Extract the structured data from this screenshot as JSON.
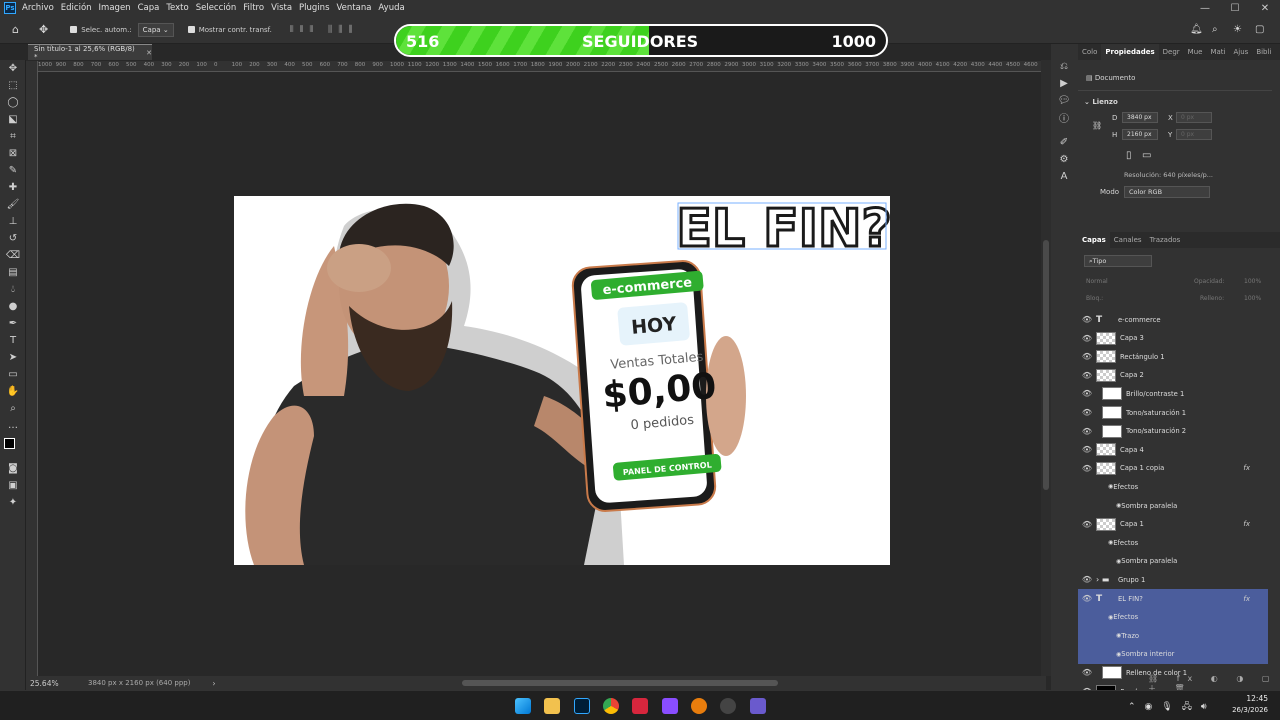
{
  "menubar": {
    "app_icon": "Ps",
    "items": [
      "Archivo",
      "Edición",
      "Imagen",
      "Capa",
      "Texto",
      "Selección",
      "Filtro",
      "Vista",
      "Plugins",
      "Ventana",
      "Ayuda"
    ]
  },
  "options_bar": {
    "auto_select_label": "Selec. autom.:",
    "auto_select_target": "Capa",
    "show_transform_label": "Mostrar contr. transf."
  },
  "overlay_bar": {
    "current": "516",
    "label": "SEGUIDORES",
    "goal": "1000",
    "progress_fraction": 0.516,
    "fill_color": "#3ed11e"
  },
  "document": {
    "tab_title": "Sin título-1 al 25,6% (RGB/8) *",
    "zoom": "25.64%",
    "size_info": "3840 px x 2160 px (640 ppp)"
  },
  "ruler_marks": [
    "1000",
    "900",
    "800",
    "700",
    "600",
    "500",
    "400",
    "300",
    "200",
    "100",
    "0",
    "100",
    "200",
    "300",
    "400",
    "500",
    "600",
    "700",
    "800",
    "900",
    "1000",
    "1100",
    "1200",
    "1300",
    "1400",
    "1500",
    "1600",
    "1700",
    "1800",
    "1900",
    "2000",
    "2100",
    "2200",
    "2300",
    "2400",
    "2500",
    "2600",
    "2700",
    "2800",
    "2900",
    "3000",
    "3100",
    "3200",
    "3300",
    "3400",
    "3500",
    "3600",
    "3700",
    "3800",
    "3900",
    "4000",
    "4100",
    "4200",
    "4300",
    "4400",
    "4500",
    "4600"
  ],
  "canvas": {
    "headline": "EL FIN?",
    "phone": {
      "banner": "e-commerce",
      "today": "HOY",
      "sales_label": "Ventas Totales",
      "amount": "$0,00",
      "orders": "0 pedidos",
      "button": "PANEL DE CONTROL"
    }
  },
  "properties_panel": {
    "tabs": [
      "Colo",
      "Propiedades",
      "Degr",
      "Mue",
      "Mati",
      "Ajus",
      "Bibli"
    ],
    "active_tab": "Propiedades",
    "doc_label": "Documento",
    "section": "Lienzo",
    "width_label": "D",
    "width_value": "3840 px",
    "height_label": "H",
    "height_value": "2160 px",
    "x_label": "X",
    "x_placeholder": "0 px",
    "y_label": "Y",
    "y_placeholder": "0 px",
    "resolution": "Resolución: 640 píxeles/p...",
    "mode_label": "Modo",
    "mode_value": "Color RGB"
  },
  "layers_panel": {
    "tabs": [
      "Capas",
      "Canales",
      "Trazados"
    ],
    "active_tab": "Capas",
    "filter": "Tipo",
    "blend_mode": "Normal",
    "opacity_label": "Opacidad:",
    "opacity_value": "100%",
    "lock_label": "Bloq.:",
    "fill_label": "Relleno:",
    "fill_value": "100%",
    "layers": [
      {
        "name": "e-commerce",
        "kind": "text"
      },
      {
        "name": "Capa 3",
        "kind": "layer"
      },
      {
        "name": "Rectángulo 1",
        "kind": "layer"
      },
      {
        "name": "Capa 2",
        "kind": "layer"
      },
      {
        "name": "Brillo/contraste 1",
        "kind": "adjust"
      },
      {
        "name": "Tono/saturación 1",
        "kind": "adjust"
      },
      {
        "name": "Tono/saturación 2",
        "kind": "adjust"
      },
      {
        "name": "Capa 4",
        "kind": "layer"
      },
      {
        "name": "Capa 1 copia",
        "kind": "layer",
        "fx": "fx"
      },
      {
        "name": "Efectos",
        "kind": "sub"
      },
      {
        "name": "Sombra paralela",
        "kind": "sub2"
      },
      {
        "name": "Capa 1",
        "kind": "layer",
        "fx": "fx"
      },
      {
        "name": "Efectos",
        "kind": "sub"
      },
      {
        "name": "Sombra paralela",
        "kind": "sub2"
      },
      {
        "name": "Grupo 1",
        "kind": "group"
      },
      {
        "name": "EL FIN?",
        "kind": "text",
        "fx": "fx",
        "selected": true
      },
      {
        "name": "Efectos",
        "kind": "sub",
        "selected": true
      },
      {
        "name": "Trazo",
        "kind": "sub2",
        "selected": true
      },
      {
        "name": "Sombra interior",
        "kind": "sub2",
        "selected": true
      },
      {
        "name": "Relleno de color 1",
        "kind": "fill"
      },
      {
        "name": "Fondo",
        "kind": "bg"
      }
    ]
  },
  "taskbar": {
    "time": "12:45",
    "date": "26/3/2026"
  }
}
